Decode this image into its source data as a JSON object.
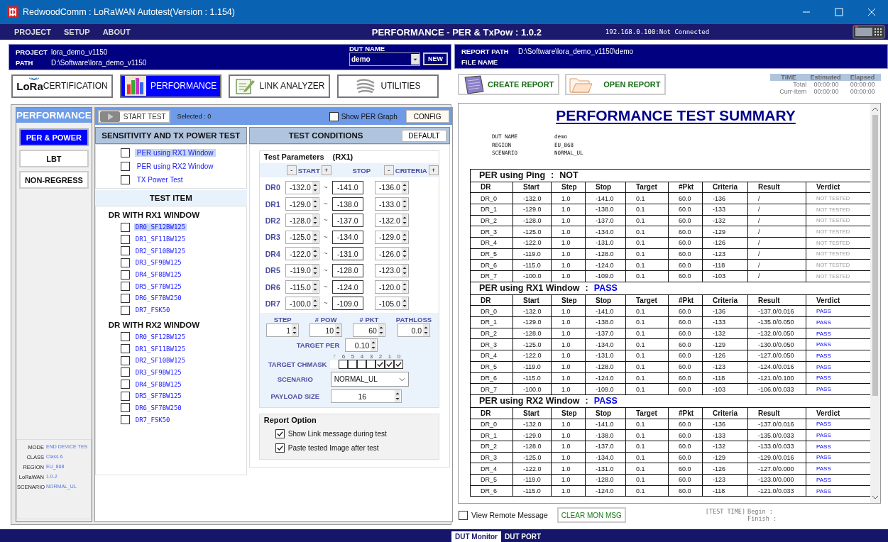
{
  "window": {
    "title": "RedwoodComm : LoRaWAN Autotest(Version : 1.154)"
  },
  "menu": [
    {
      "label": "PROJECT"
    },
    {
      "label": "SETUP"
    },
    {
      "label": "ABOUT"
    }
  ],
  "mode_title": "PERFORMANCE - PER & TxPow : 1.0.2",
  "connection": "192.168.0.100:Not Connected",
  "project": {
    "project_label": "PROJECT",
    "project": "lora_demo_v1150",
    "path_label": "PATH",
    "path": "D:\\Software\\lora_demo_v1150",
    "dut_label": "DUT NAME",
    "dut_name": "demo",
    "new_button": "NEW"
  },
  "modules": [
    {
      "kind": "lora",
      "logo": "LoRa",
      "label": "CERTIFICATION",
      "selected": false
    },
    {
      "kind": "chart",
      "label": "PERFORMANCE",
      "selected": true
    },
    {
      "kind": "pen",
      "label": "LINK ANALYZER",
      "selected": false
    },
    {
      "kind": "tools",
      "label": "UTILITIES",
      "selected": false
    }
  ],
  "sidebar": {
    "title": "PERFORMANCE",
    "items": [
      {
        "label": "PER & POWER",
        "selected": true
      },
      {
        "label": "LBT",
        "selected": false
      },
      {
        "label": "NON-REGRESS",
        "selected": false
      }
    ],
    "info": [
      {
        "label": "MODE",
        "value": "END DEVICE TES"
      },
      {
        "label": "CLASS",
        "value": "Class A"
      },
      {
        "label": "REGION",
        "value": "EU_868"
      },
      {
        "label": "LoRaWAN",
        "value": "1.0.2"
      },
      {
        "label": "SCENARIO",
        "value": "NORMAL_UL"
      }
    ]
  },
  "toolbar": {
    "start_button": "START TEST",
    "selected_count": "Selected : 0",
    "show_graph": {
      "label": "Show PER Graph",
      "checked": false
    },
    "config_button": "CONFIG"
  },
  "tests": {
    "title": "SENSITIVITY AND TX POWER TEST",
    "items": [
      {
        "label": "PER using RX1 Window",
        "checked": false,
        "selected": true
      },
      {
        "label": "PER using RX2 Window",
        "checked": false,
        "selected": false
      },
      {
        "label": "TX Power Test",
        "checked": false,
        "selected": false
      }
    ]
  },
  "test_items": {
    "title": "TEST ITEM",
    "groups": [
      {
        "title": "DR WITH RX1 WINDOW",
        "items": [
          {
            "label": "DR0_SF12BW125",
            "checked": false,
            "selected": true
          },
          {
            "label": "DR1_SF11BW125",
            "checked": false,
            "selected": false
          },
          {
            "label": "DR2_SF10BW125",
            "checked": false,
            "selected": false
          },
          {
            "label": "DR3_SF9BW125",
            "checked": false,
            "selected": false
          },
          {
            "label": "DR4_SF8BW125",
            "checked": false,
            "selected": false
          },
          {
            "label": "DR5_SF7BW125",
            "checked": false,
            "selected": false
          },
          {
            "label": "DR6_SF7BW250",
            "checked": false,
            "selected": false
          },
          {
            "label": "DR7_FSK50",
            "checked": false,
            "selected": false
          }
        ]
      },
      {
        "title": "DR WITH RX2 WINDOW",
        "items": [
          {
            "label": "DR0_SF12BW125",
            "checked": false,
            "selected": false
          },
          {
            "label": "DR1_SF11BW125",
            "checked": false,
            "selected": false
          },
          {
            "label": "DR2_SF10BW125",
            "checked": false,
            "selected": false
          },
          {
            "label": "DR3_SF9BW125",
            "checked": false,
            "selected": false
          },
          {
            "label": "DR4_SF8BW125",
            "checked": false,
            "selected": false
          },
          {
            "label": "DR5_SF7BW125",
            "checked": false,
            "selected": false
          },
          {
            "label": "DR6_SF7BW250",
            "checked": false,
            "selected": false
          },
          {
            "label": "DR7_FSK50",
            "checked": false,
            "selected": false
          }
        ]
      }
    ]
  },
  "conditions": {
    "title": "TEST CONDITIONS",
    "default_button": "DEFAULT",
    "params_title": "Test Parameters",
    "params_rx": "(RX1)",
    "param_header": [
      {
        "kind": "adjust",
        "minus": "-",
        "label": "START",
        "plus": "+"
      },
      {
        "kind": "plain",
        "label": "STOP"
      },
      {
        "kind": "adjust",
        "minus": "-",
        "label": "CRITERIA",
        "plus": "+"
      }
    ],
    "tilde": "~",
    "rows": [
      {
        "dr": "DR0",
        "start": "-132.0",
        "stop": "-141.0",
        "criteria": "-136.0"
      },
      {
        "dr": "DR1",
        "start": "-129.0",
        "stop": "-138.0",
        "criteria": "-133.0"
      },
      {
        "dr": "DR2",
        "start": "-128.0",
        "stop": "-137.0",
        "criteria": "-132.0"
      },
      {
        "dr": "DR3",
        "start": "-125.0",
        "stop": "-134.0",
        "criteria": "-129.0"
      },
      {
        "dr": "DR4",
        "start": "-122.0",
        "stop": "-131.0",
        "criteria": "-126.0"
      },
      {
        "dr": "DR5",
        "start": "-119.0",
        "stop": "-128.0",
        "criteria": "-123.0"
      },
      {
        "dr": "DR6",
        "start": "-115.0",
        "stop": "-124.0",
        "criteria": "-120.0"
      },
      {
        "dr": "DR7",
        "start": "-100.0",
        "stop": "-109.0",
        "criteria": "-105.0"
      }
    ],
    "settings": [
      {
        "label": "STEP",
        "value": "1"
      },
      {
        "label": "# POW",
        "value": "10"
      },
      {
        "label": "# PKT",
        "value": "60"
      },
      {
        "label": "PATHLOSS",
        "value": "0.0"
      }
    ],
    "target_per": {
      "label": "TARGET PER",
      "value": "0.10"
    },
    "chmask": {
      "label": "TARGET CHMASK",
      "bits": [
        {
          "index": "7",
          "checked": false,
          "enabled": false
        },
        {
          "index": "6",
          "checked": false,
          "enabled": true
        },
        {
          "index": "5",
          "checked": false,
          "enabled": true
        },
        {
          "index": "4",
          "checked": false,
          "enabled": true
        },
        {
          "index": "3",
          "checked": false,
          "enabled": true
        },
        {
          "index": "2",
          "checked": true,
          "enabled": true
        },
        {
          "index": "1",
          "checked": true,
          "enabled": true
        },
        {
          "index": "0",
          "checked": true,
          "enabled": true
        }
      ]
    },
    "scenario": {
      "label": "SCENARIO",
      "value": "NORMAL_UL"
    },
    "payload": {
      "label": "PAYLOAD SIZE",
      "value": "16"
    }
  },
  "report_option": {
    "title": "Report Option",
    "items": [
      {
        "label": "Show Link message during test",
        "checked": true
      },
      {
        "label": "Paste tested Image after test",
        "checked": true
      }
    ]
  },
  "report_header": {
    "path_label": "REPORT PATH",
    "path": "D:\\Software\\lora_demo_v1150\\demo",
    "file_label": "FILE NAME"
  },
  "report_buttons": [
    {
      "kind": "create",
      "label": "CREATE REPORT"
    },
    {
      "kind": "open",
      "label": "OPEN REPORT"
    }
  ],
  "time": {
    "header": [
      "TIME",
      "Estimated",
      "Elapsed"
    ],
    "rows": [
      {
        "label": "Total",
        "estimated": "00:00:00",
        "elapsed": "00:00:00"
      },
      {
        "label": "Curr-Item",
        "estimated": "00:00:00",
        "elapsed": "00:00:00"
      }
    ]
  },
  "report": {
    "title": "PERFORMANCE TEST SUMMARY",
    "info": [
      {
        "label": "DUT NAME",
        "value": "demo"
      },
      {
        "label": "REGION",
        "value": "EU_868"
      },
      {
        "label": "SCENARIO",
        "value": "NORMAL_UL"
      }
    ],
    "sections": [
      {
        "title": "PER using Ping",
        "separator": ":",
        "verdict": "NOT",
        "passed": false,
        "columns": [
          "DR",
          "Start",
          "Step",
          "Stop",
          "Target",
          "#Pkt",
          "Criteria",
          "Result",
          "Verdict"
        ],
        "rows": [
          [
            "DR_0",
            "-132.0",
            "1.0",
            "-141.0",
            "0.1",
            "60.0",
            "-136",
            "/",
            "NOT TESTED"
          ],
          [
            "DR_1",
            "-129.0",
            "1.0",
            "-138.0",
            "0.1",
            "60.0",
            "-133",
            "/",
            "NOT TESTED"
          ],
          [
            "DR_2",
            "-128.0",
            "1.0",
            "-137.0",
            "0.1",
            "60.0",
            "-132",
            "/",
            "NOT TESTED"
          ],
          [
            "DR_3",
            "-125.0",
            "1.0",
            "-134.0",
            "0.1",
            "60.0",
            "-129",
            "/",
            "NOT TESTED"
          ],
          [
            "DR_4",
            "-122.0",
            "1.0",
            "-131.0",
            "0.1",
            "60.0",
            "-126",
            "/",
            "NOT TESTED"
          ],
          [
            "DR_5",
            "-119.0",
            "1.0",
            "-128.0",
            "0.1",
            "60.0",
            "-123",
            "/",
            "NOT TESTED"
          ],
          [
            "DR_6",
            "-115.0",
            "1.0",
            "-124.0",
            "0.1",
            "60.0",
            "-118",
            "/",
            "NOT TESTED"
          ],
          [
            "DR_7",
            "-100.0",
            "1.0",
            "-109.0",
            "0.1",
            "60.0",
            "-103",
            "/",
            "NOT TESTED"
          ]
        ]
      },
      {
        "title": "PER using RX1 Window",
        "separator": ":",
        "verdict": "PASS",
        "passed": true,
        "columns": [
          "DR",
          "Start",
          "Step",
          "Stop",
          "Target",
          "#Pkt",
          "Criteria",
          "Result",
          "Verdict"
        ],
        "rows": [
          [
            "DR_0",
            "-132.0",
            "1.0",
            "-141.0",
            "0.1",
            "60.0",
            "-136",
            "-137.0/0.016",
            "PASS"
          ],
          [
            "DR_1",
            "-129.0",
            "1.0",
            "-138.0",
            "0.1",
            "60.0",
            "-133",
            "-135.0/0.050",
            "PASS"
          ],
          [
            "DR_2",
            "-128.0",
            "1.0",
            "-137.0",
            "0.1",
            "60.0",
            "-132",
            "-132.0/0.050",
            "PASS"
          ],
          [
            "DR_3",
            "-125.0",
            "1.0",
            "-134.0",
            "0.1",
            "60.0",
            "-129",
            "-130.0/0.050",
            "PASS"
          ],
          [
            "DR_4",
            "-122.0",
            "1.0",
            "-131.0",
            "0.1",
            "60.0",
            "-126",
            "-127.0/0.050",
            "PASS"
          ],
          [
            "DR_5",
            "-119.0",
            "1.0",
            "-128.0",
            "0.1",
            "60.0",
            "-123",
            "-124.0/0.016",
            "PASS"
          ],
          [
            "DR_6",
            "-115.0",
            "1.0",
            "-124.0",
            "0.1",
            "60.0",
            "-118",
            "-121.0/0.100",
            "PASS"
          ],
          [
            "DR_7",
            "-100.0",
            "1.0",
            "-109.0",
            "0.1",
            "60.0",
            "-103",
            "-106.0/0.033",
            "PASS"
          ]
        ]
      },
      {
        "title": "PER using RX2 Window",
        "separator": ":",
        "verdict": "PASS",
        "passed": true,
        "columns": [
          "DR",
          "Start",
          "Step",
          "Stop",
          "Target",
          "#Pkt",
          "Criteria",
          "Result",
          "Verdict"
        ],
        "rows": [
          [
            "DR_0",
            "-132.0",
            "1.0",
            "-141.0",
            "0.1",
            "60.0",
            "-136",
            "-137.0/0.016",
            "PASS"
          ],
          [
            "DR_1",
            "-129.0",
            "1.0",
            "-138.0",
            "0.1",
            "60.0",
            "-133",
            "-135.0/0.033",
            "PASS"
          ],
          [
            "DR_2",
            "-128.0",
            "1.0",
            "-137.0",
            "0.1",
            "60.0",
            "-132",
            "-133.0/0.033",
            "PASS"
          ],
          [
            "DR_3",
            "-125.0",
            "1.0",
            "-134.0",
            "0.1",
            "60.0",
            "-129",
            "-129.0/0.016",
            "PASS"
          ],
          [
            "DR_4",
            "-122.0",
            "1.0",
            "-131.0",
            "0.1",
            "60.0",
            "-126",
            "-127.0/0.000",
            "PASS"
          ],
          [
            "DR_5",
            "-119.0",
            "1.0",
            "-128.0",
            "0.1",
            "60.0",
            "-123",
            "-123.0/0.000",
            "PASS"
          ],
          [
            "DR_6",
            "-115.0",
            "1.0",
            "-124.0",
            "0.1",
            "60.0",
            "-118",
            "-121.0/0.033",
            "PASS"
          ]
        ]
      }
    ]
  },
  "monitor": {
    "view_remote": {
      "label": "View Remote Message",
      "checked": false
    },
    "clear_button": "CLEAR MON MSG",
    "test_time_label": "[TEST TIME]",
    "begin_label": "Begin  :",
    "finish_label": "Finish :"
  },
  "bottom_tabs": [
    {
      "label": "DUT Monitor",
      "selected": true
    },
    {
      "label": "DUT PORT",
      "selected": false
    }
  ]
}
